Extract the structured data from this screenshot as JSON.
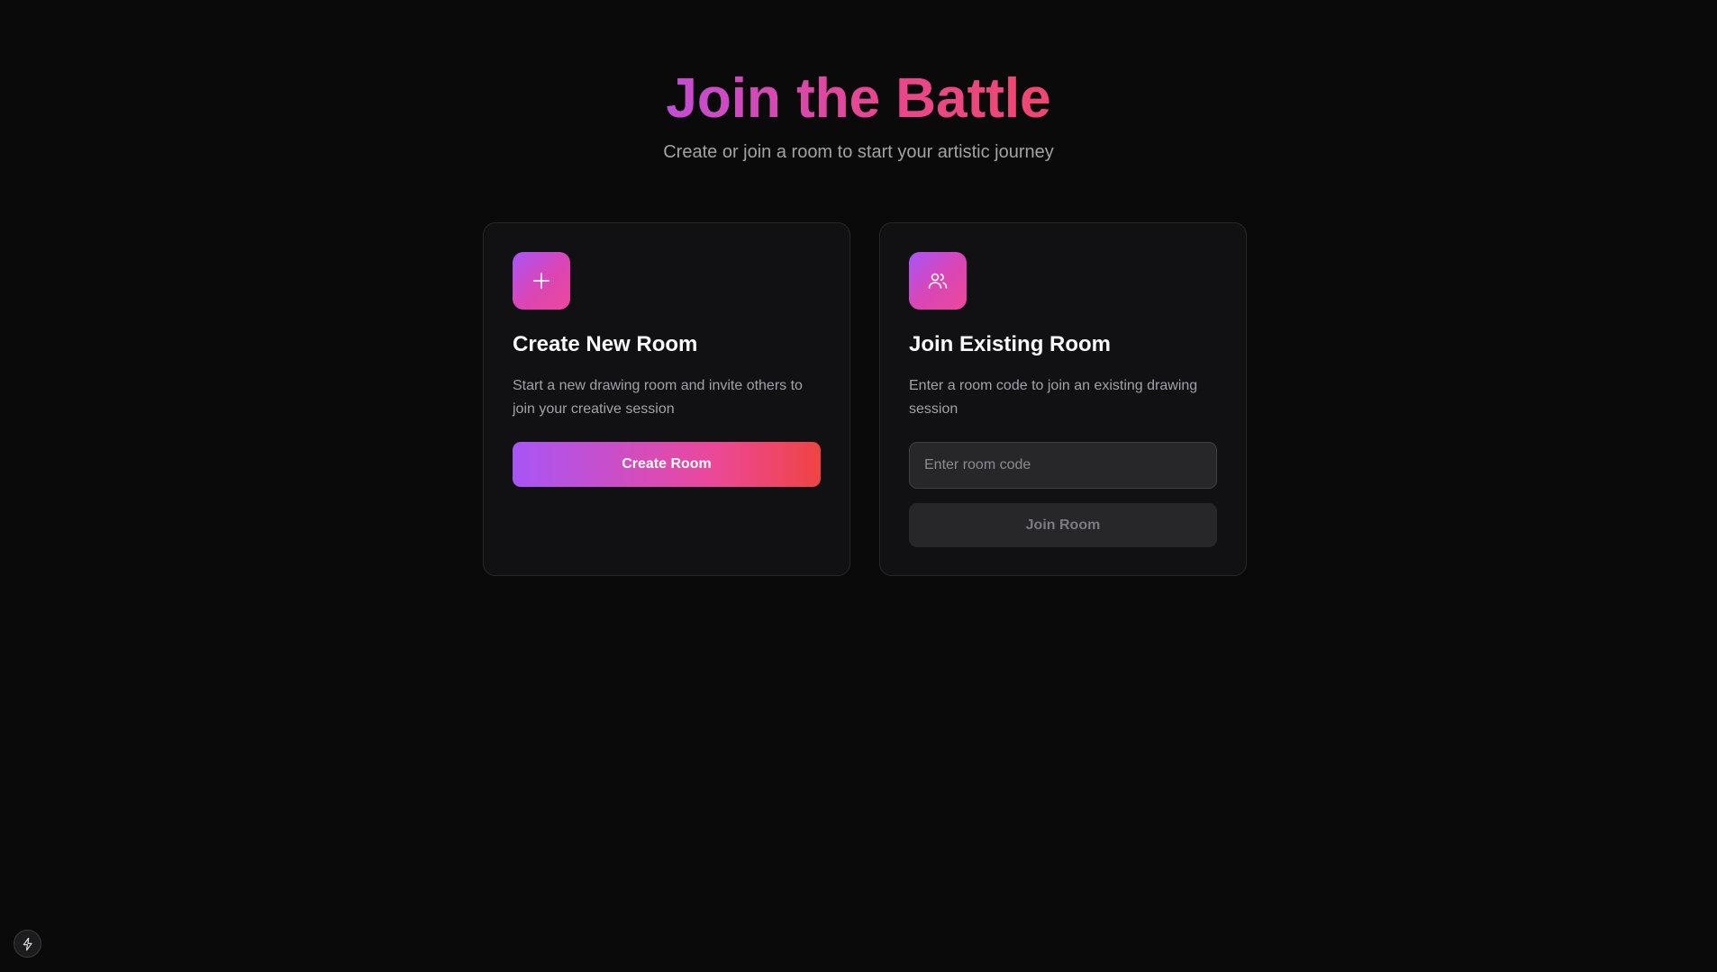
{
  "hero": {
    "title": "Join the Battle",
    "subtitle": "Create or join a room to start your artistic journey"
  },
  "create_card": {
    "icon": "plus-icon",
    "title": "Create New Room",
    "description": "Start a new drawing room and invite others to join your creative session",
    "button_label": "Create Room"
  },
  "join_card": {
    "icon": "users-icon",
    "title": "Join Existing Room",
    "description": "Enter a room code to join an existing drawing session",
    "input": {
      "value": "",
      "placeholder": "Enter room code"
    },
    "button_label": "Join Room",
    "button_disabled": true
  },
  "corner_badge": {
    "icon": "bolt-icon"
  },
  "colors": {
    "background": "#0a0a0a",
    "card": "#111113",
    "accent_start": "#a855f7",
    "accent_mid": "#ec4899",
    "accent_end": "#ef4444"
  }
}
